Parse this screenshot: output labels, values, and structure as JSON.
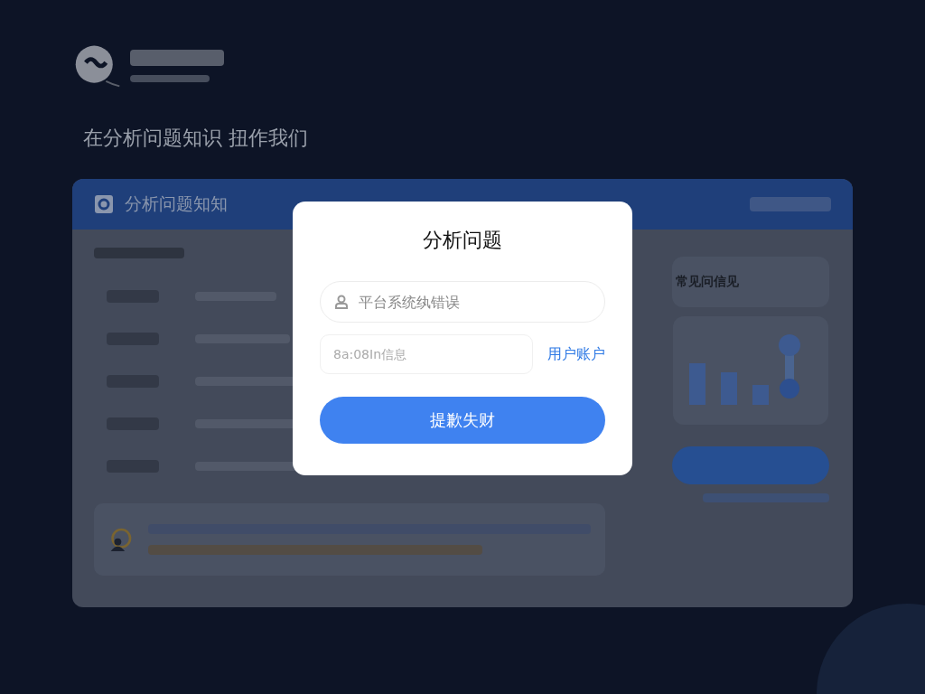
{
  "page": {
    "heading": "在分析问题知识 扭作我们"
  },
  "card": {
    "title": "分析问题知知",
    "side_panel": {
      "title": "常见问信见"
    }
  },
  "dialog": {
    "title": "分析问题",
    "search_field": {
      "placeholder": "平台系统纨错误"
    },
    "info_field": {
      "placeholder": "8a:08In信息"
    },
    "account_link": "用户账户",
    "submit_button": "提歉失财"
  }
}
